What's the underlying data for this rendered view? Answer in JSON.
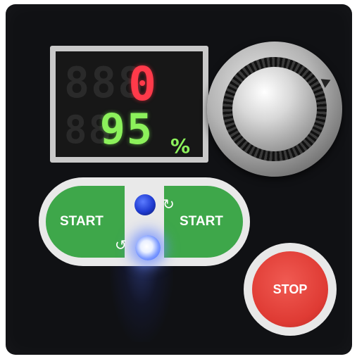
{
  "display": {
    "top_value": "0",
    "bottom_value": "95",
    "unit": "%",
    "ghost_top": "888",
    "ghost_bottom": "88"
  },
  "controls": {
    "start_left_label": "START",
    "start_right_label": "START",
    "stop_label": "STOP",
    "cw_arrow": "↻",
    "ccw_arrow": "↺"
  },
  "colors": {
    "panel": "#101114",
    "display_red": "#ff3a4a",
    "display_green": "#8cf15b",
    "start_green": "#3ea74a",
    "stop_red": "#df3b34",
    "led_blue": "#2f57ff"
  },
  "icons": {
    "knob": "rotary-knob-icon",
    "forward": "rotate-clockwise-icon",
    "reverse": "rotate-counterclockwise-icon"
  }
}
